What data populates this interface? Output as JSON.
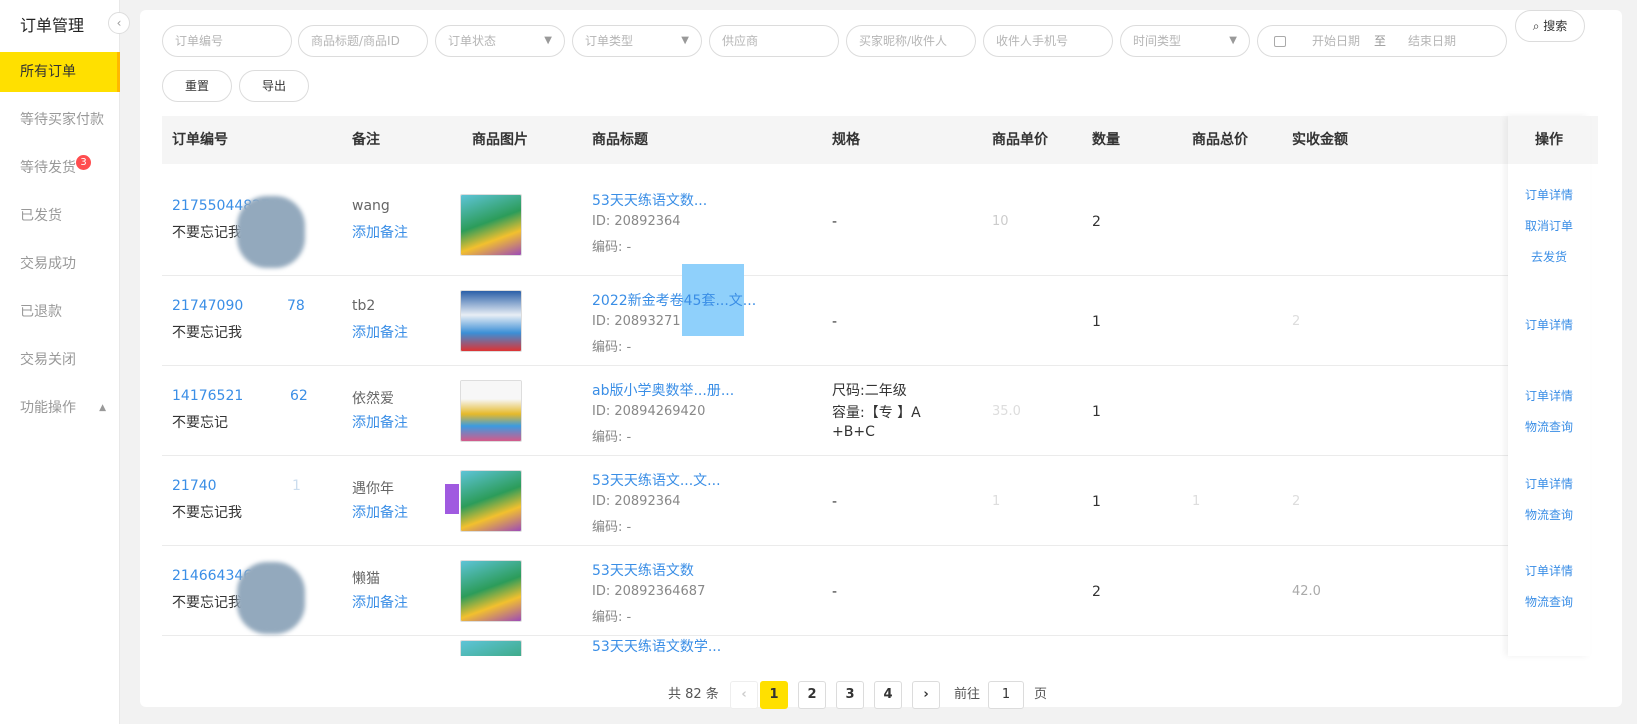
{
  "sidebar": {
    "title": "订单管理",
    "items": [
      {
        "label": "所有订单",
        "active": true
      },
      {
        "label": "等待买家付款"
      },
      {
        "label": "等待发货",
        "badge": "3"
      },
      {
        "label": "已发货"
      },
      {
        "label": "交易成功"
      },
      {
        "label": "已退款"
      },
      {
        "label": "交易关闭"
      },
      {
        "label": "功能操作"
      }
    ]
  },
  "filters": {
    "order_no": "订单编号",
    "product": "商品标题/商品ID",
    "order_status": "订单状态",
    "order_type": "订单类型",
    "supplier": "供应商",
    "buyer": "买家昵称/收件人",
    "phone": "收件人手机号",
    "time_type": "时间类型",
    "start_date": "开始日期",
    "to": "至",
    "end_date": "结束日期",
    "search": "搜索",
    "reset": "重置",
    "export": "导出"
  },
  "table": {
    "headers": [
      "订单编号",
      "备注",
      "商品图片",
      "商品标题",
      "规格",
      "商品单价",
      "数量",
      "商品总价",
      "实收金额",
      "操作"
    ],
    "rows": [
      {
        "order_no": "21755044827",
        "note": "不要忘记我",
        "remark": "wang",
        "add_remark": "添加备注",
        "title": "53天天练语文数...",
        "pid": "ID: 20892364",
        "code": "编码: -",
        "spec": "-",
        "price": "10",
        "qty": "2",
        "total": "",
        "paid": "",
        "ops": [
          "订单详情",
          "取消订单",
          "去发货"
        ]
      },
      {
        "order_no": "21747090",
        "order_no_tail": "78",
        "note": "不要忘记我",
        "remark": "tb2",
        "add_remark": "添加备注",
        "title": "2022新金考卷45套...文...",
        "pid": "ID: 20893271",
        "code": "编码: -",
        "spec": "-",
        "price": "",
        "qty": "1",
        "total": "",
        "paid": "2",
        "ops": [
          "订单详情"
        ]
      },
      {
        "order_no": "14176521",
        "order_no_tail": "62",
        "note": "不要忘记",
        "remark": "依然爱",
        "add_remark": "添加备注",
        "title": "ab版小学奥数举...册...",
        "pid": "ID: 20894269420",
        "code": "编码: -",
        "spec": "尺码:二年级",
        "spec2": "容量:【专    】A",
        "spec3": "+B+C",
        "price": "35.0",
        "qty": "1",
        "total": "",
        "paid": "",
        "ops": [
          "订单详情",
          "物流查询"
        ]
      },
      {
        "order_no": "21740",
        "order_no_tail": "1",
        "note": "不要忘记我",
        "remark": "遇你年",
        "add_remark": "添加备注",
        "title": "53天天练语文...文...",
        "pid": "ID: 20892364",
        "code": "编码: -",
        "spec": "-",
        "price": "1",
        "qty": "1",
        "total": "1",
        "paid": "2",
        "ops": [
          "订单详情",
          "物流查询"
        ]
      },
      {
        "order_no": "2146643462",
        "order_no_tail": "5",
        "note": "不要忘记我女",
        "remark": "懒猫",
        "add_remark": "添加备注",
        "title": "53天天练语文数",
        "pid": "ID: 20892364687",
        "code": "编码: -",
        "spec": "-",
        "price": "",
        "qty": "2",
        "total": "",
        "paid": "42.0",
        "ops": [
          "订单详情",
          "物流查询"
        ]
      },
      {
        "title": "53天天练语文数学..."
      }
    ]
  },
  "pagination": {
    "total": "共 82 条",
    "pages": [
      "1",
      "2",
      "3",
      "4"
    ],
    "next": "›",
    "goto": "前往",
    "goto_value": "1",
    "page_unit": "页"
  }
}
